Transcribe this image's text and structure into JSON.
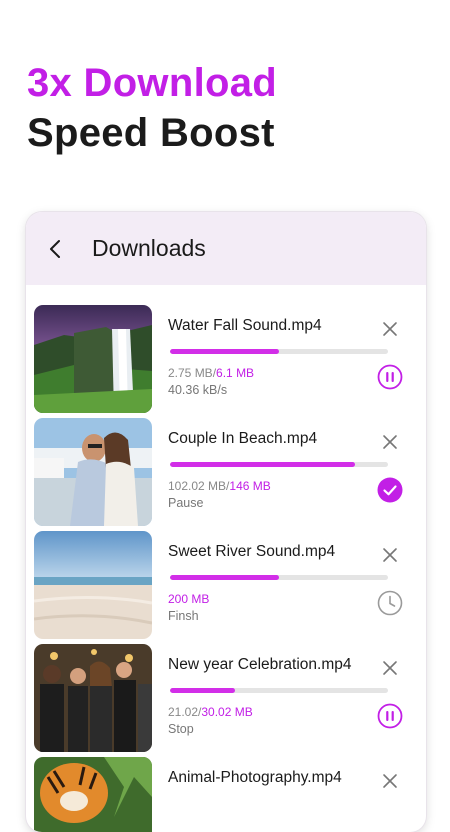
{
  "promo": {
    "line1": "3x Download",
    "line2": "Speed Boost"
  },
  "appbar": {
    "title": "Downloads"
  },
  "colors": {
    "accent": "#c21fe6",
    "progress": "#d22ee8",
    "appbar_bg": "#f3ecf6",
    "muted": "#888888"
  },
  "downloads": [
    {
      "name": "Water Fall Sound.mp4",
      "downloaded": "2.75 MB",
      "total": "6.1 MB",
      "detail": "40.36 kB/s",
      "progress": 0.5,
      "status_icon": "pause-icon"
    },
    {
      "name": "Couple In Beach.mp4",
      "downloaded": "102.02 MB",
      "total": "146 MB",
      "detail": "Pause",
      "progress": 0.85,
      "status_icon": "check-circle-icon"
    },
    {
      "name": "Sweet River Sound.mp4",
      "size": "200 MB",
      "detail": "Finsh",
      "progress": 0.5,
      "status_icon": "clock-icon"
    },
    {
      "name": "New year Celebration.mp4",
      "downloaded": "21.02",
      "total": "30.02 MB",
      "detail": "Stop",
      "progress": 0.3,
      "status_icon": "pause-icon"
    },
    {
      "name": "Animal-Photography.mp4"
    }
  ]
}
